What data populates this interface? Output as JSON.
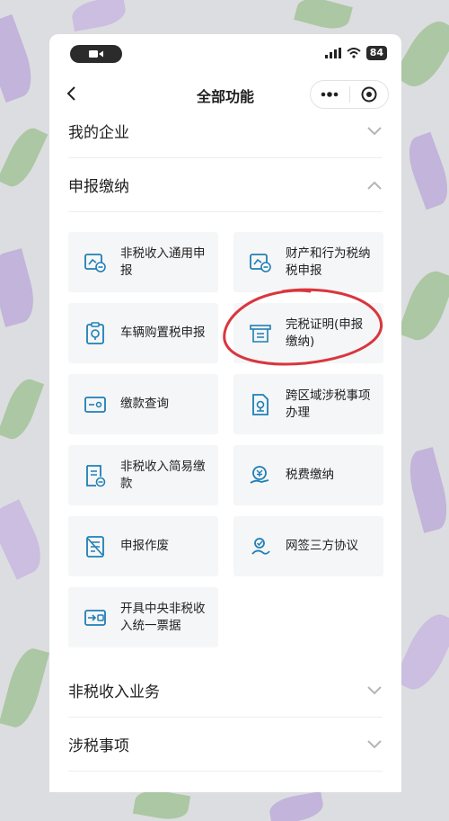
{
  "status": {
    "battery": "84"
  },
  "nav": {
    "title": "全部功能"
  },
  "sections": {
    "enterprise": "我的企业",
    "declare": "申报缴纳",
    "nontax": "非税收入业务",
    "taxmatters": "涉税事项"
  },
  "cards": [
    {
      "label": "非税收入通用申报",
      "icon": "nontax-declare-icon"
    },
    {
      "label": "财产和行为税纳税申报",
      "icon": "property-tax-icon"
    },
    {
      "label": "车辆购置税申报",
      "icon": "vehicle-tax-icon"
    },
    {
      "label": "完税证明(申报缴纳)",
      "icon": "tax-certificate-icon"
    },
    {
      "label": "缴款查询",
      "icon": "payment-query-icon"
    },
    {
      "label": "跨区域涉税事项办理",
      "icon": "cross-region-icon"
    },
    {
      "label": "非税收入简易缴款",
      "icon": "nontax-simple-pay-icon"
    },
    {
      "label": "税费缴纳",
      "icon": "tax-payment-icon"
    },
    {
      "label": "申报作废",
      "icon": "declare-void-icon"
    },
    {
      "label": "网签三方协议",
      "icon": "tripartite-agreement-icon"
    },
    {
      "label": "开具中央非税收入统一票据",
      "icon": "central-bill-icon"
    }
  ],
  "colors": {
    "accent": "#1f7fb5",
    "annotation": "#d9363e"
  }
}
